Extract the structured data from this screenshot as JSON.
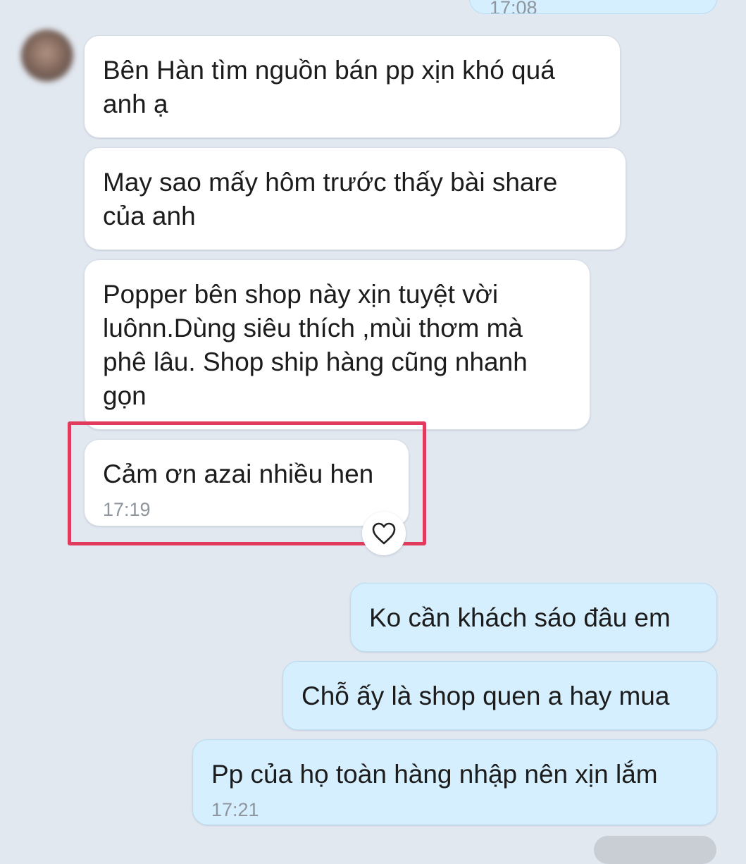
{
  "conversation": {
    "top_partial_time": "17:08",
    "messages": [
      {
        "direction": "incoming",
        "text": "Bên Hàn tìm nguồn bán pp xịn khó quá anh ạ"
      },
      {
        "direction": "incoming",
        "text": "May sao mấy hôm trước thấy bài share của anh"
      },
      {
        "direction": "incoming",
        "text": "Popper bên shop này xịn tuyệt vời luônn.Dùng siêu thích ,mùi thơm mà phê lâu. Shop ship hàng cũng nhanh gọn"
      },
      {
        "direction": "incoming",
        "text": "Cảm ơn azai nhiều hen",
        "time": "17:19",
        "highlighted": true,
        "reaction": "heart-outline"
      },
      {
        "direction": "outgoing",
        "text": "Ko cần khách sáo đâu em"
      },
      {
        "direction": "outgoing",
        "text": "Chỗ ấy là shop quen a hay mua"
      },
      {
        "direction": "outgoing",
        "text": "Pp của họ toàn hàng nhập nên xịn lắm",
        "time": "17:21"
      }
    ]
  },
  "colors": {
    "background": "#e2e8f0",
    "incoming_bubble": "#ffffff",
    "outgoing_bubble": "#d5efff",
    "highlight": "#e03a5c",
    "timestamp": "#8e959e"
  },
  "icons": {
    "reaction": "heart-icon"
  }
}
